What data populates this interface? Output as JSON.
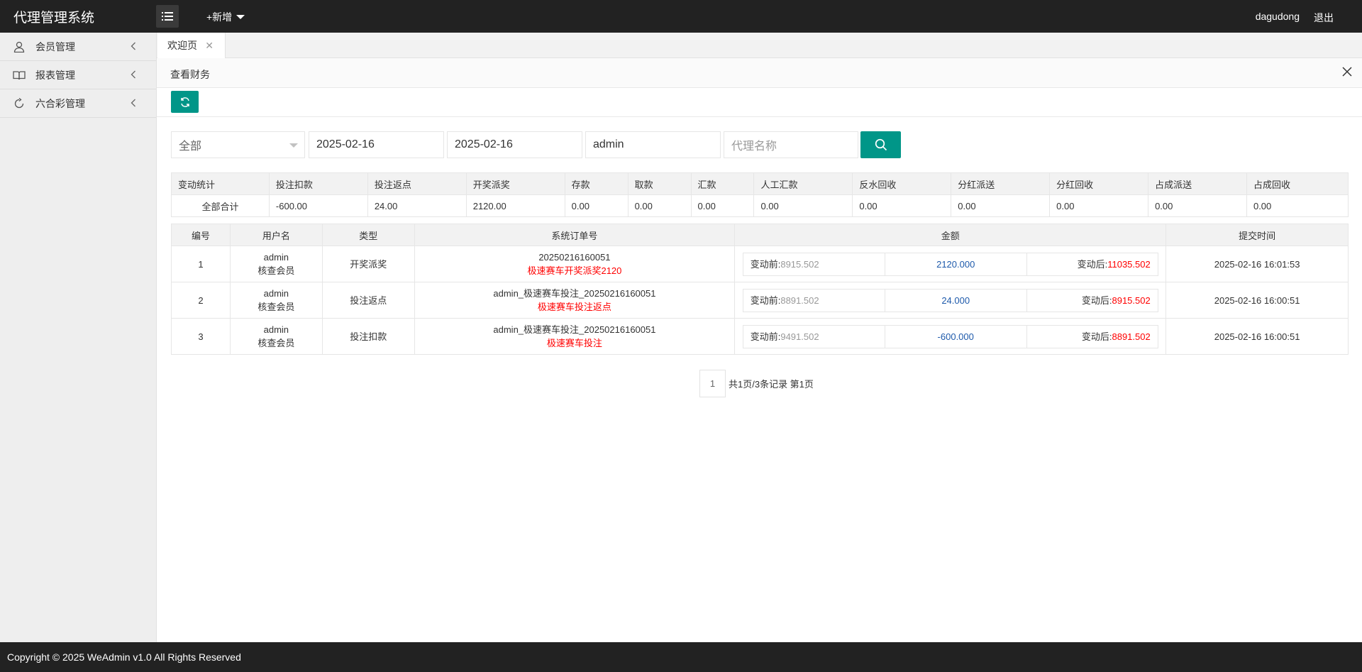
{
  "header": {
    "title": "代理管理系统",
    "new_label": "+新增",
    "username": "dagudong",
    "logout": "退出"
  },
  "sidebar": {
    "items": [
      {
        "label": "会员管理",
        "icon": "user-icon"
      },
      {
        "label": "报表管理",
        "icon": "book-icon"
      },
      {
        "label": "六合彩管理",
        "icon": "refresh-icon"
      }
    ]
  },
  "tabs": [
    {
      "label": "欢迎页"
    }
  ],
  "panel": {
    "title": "查看财务"
  },
  "filters": {
    "type_value": "全部",
    "start_date": "2025-02-16",
    "end_date": "2025-02-16",
    "username": "admin",
    "agent_placeholder": "代理名称"
  },
  "stats": {
    "headers": [
      "变动统计",
      "投注扣款",
      "投注返点",
      "开奖派奖",
      "存款",
      "取款",
      "汇款",
      "人工汇款",
      "反水回收",
      "分红派送",
      "分红回收",
      "占成派送",
      "占成回收"
    ],
    "row": [
      "全部合计",
      "-600.00",
      "24.00",
      "2120.00",
      "0.00",
      "0.00",
      "0.00",
      "0.00",
      "0.00",
      "0.00",
      "0.00",
      "0.00",
      "0.00"
    ]
  },
  "table": {
    "headers": [
      "编号",
      "用户名",
      "类型",
      "系统订单号",
      "金额",
      "提交时间"
    ],
    "before_label": "变动前:",
    "after_label": "变动后:",
    "rows": [
      {
        "id": "1",
        "user": "admin",
        "role": "核查会员",
        "type": "开奖派奖",
        "order": "20250216160051",
        "note": "极速赛车开奖派奖2120",
        "before": "8915.502",
        "amount": "2120.000",
        "after": "11035.502",
        "time": "2025-02-16 16:01:53"
      },
      {
        "id": "2",
        "user": "admin",
        "role": "核查会员",
        "type": "投注返点",
        "order": "admin_极速赛车投注_20250216160051",
        "note": "极速赛车投注返点",
        "before": "8891.502",
        "amount": "24.000",
        "after": "8915.502",
        "time": "2025-02-16 16:00:51"
      },
      {
        "id": "3",
        "user": "admin",
        "role": "核查会员",
        "type": "投注扣款",
        "order": "admin_极速赛车投注_20250216160051",
        "note": "极速赛车投注",
        "before": "9491.502",
        "amount": "-600.000",
        "after": "8891.502",
        "time": "2025-02-16 16:00:51"
      }
    ]
  },
  "pager": {
    "page": "1",
    "info": "共1页/3条记录 第1页"
  },
  "footer": {
    "text": "Copyright © 2025 WeAdmin v1.0 All Rights Reserved"
  },
  "colors": {
    "accent": "#009688",
    "header_bg": "#222222",
    "red": "#ff0000",
    "amount_blue": "#1E5AAB"
  }
}
